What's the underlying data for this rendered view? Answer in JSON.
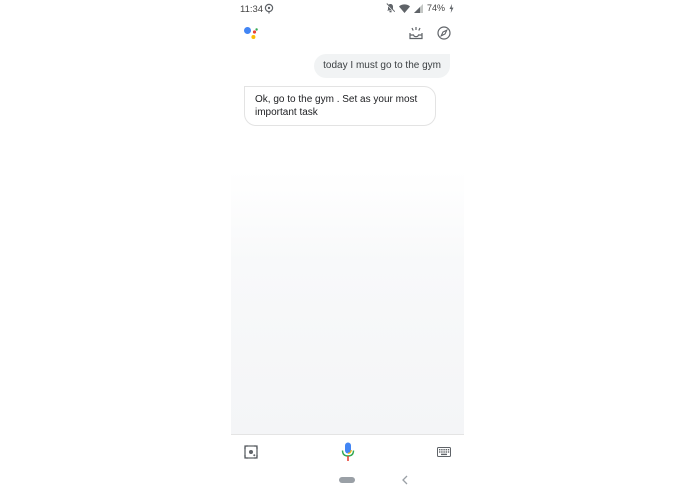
{
  "status_bar": {
    "time": "11:34",
    "battery": "74%"
  },
  "conversation": {
    "user_message": "today I must go to the gym",
    "assistant_message": "Ok, go to the gym . Set as your most important task"
  },
  "colors": {
    "google_blue": "#4285F4",
    "google_red": "#EA4335",
    "google_yellow": "#FBBC05",
    "google_green": "#34A853",
    "icon_gray": "#5f6368"
  },
  "icons": {
    "assistant_logo": "assistant-logo-icon",
    "updates": "updates-tray-icon",
    "explore": "compass-icon",
    "lens": "lens-icon",
    "mic": "mic-icon",
    "keyboard": "keyboard-icon"
  }
}
